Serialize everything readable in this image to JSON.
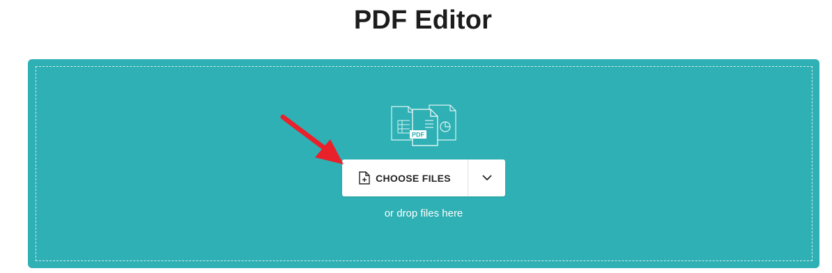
{
  "page": {
    "title": "PDF Editor"
  },
  "upload": {
    "choose_label": "CHOOSE FILES",
    "drop_hint": "or drop files here",
    "illustration_badge": "PDF"
  },
  "colors": {
    "dropzone_bg": "#2eb0b4",
    "arrow": "#e8212b",
    "title": "#1c1c1c"
  },
  "icons": {
    "file_add": "file-add-icon",
    "chevron": "chevron-down-icon",
    "illustration": "documents-illustration-icon",
    "arrow": "red-pointer-arrow-icon"
  }
}
